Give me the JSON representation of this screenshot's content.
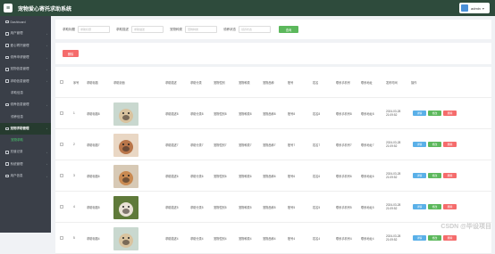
{
  "app": {
    "title": "宠物爱心寄托求助系统",
    "logo_letter": "≡"
  },
  "user": {
    "name": "admin",
    "caret": "▾"
  },
  "sidebar": {
    "items": [
      {
        "label": "Dashboard",
        "caret": ""
      },
      {
        "label": "用户管理",
        "caret": "›"
      },
      {
        "label": "爱心寄托管理",
        "caret": "›"
      },
      {
        "label": "领养申请管理",
        "caret": "›"
      },
      {
        "label": "宠物信息管理",
        "caret": "›"
      },
      {
        "label": "求助信息管理",
        "caret": "›"
      },
      {
        "label": "求助信息",
        "caret": "",
        "sub": true
      },
      {
        "label": "领养信息管理",
        "caret": "›"
      },
      {
        "label": "领养信息",
        "caret": "",
        "sub": true
      },
      {
        "label": "宠物求助管理",
        "caret": "›",
        "active": true
      },
      {
        "label": "宠物求助",
        "caret": "",
        "sub": true,
        "sub_active": true
      },
      {
        "label": "充值记录",
        "caret": "›"
      },
      {
        "label": "系统管理",
        "caret": "›"
      },
      {
        "label": "用户信息",
        "caret": "›"
      }
    ]
  },
  "search": {
    "fields": [
      {
        "label": "求助标题",
        "placeholder": "求助标题"
      },
      {
        "label": "求助描述",
        "placeholder": "求助描述"
      },
      {
        "label": "宠物种类",
        "placeholder": "宠物种类"
      },
      {
        "label": "领养状态",
        "placeholder": "领养状态"
      }
    ],
    "button": "查询"
  },
  "actions": {
    "delete": "删除"
  },
  "table": {
    "headers": [
      "序号",
      "求助标题",
      "求助封面",
      "求助描述",
      "求助分类",
      "宠物性别",
      "宠物种类",
      "宠物品种",
      "账号",
      "姓名",
      "联系手机号",
      "联系地址",
      "发布时间",
      "操作"
    ],
    "ops": {
      "detail": "详情",
      "edit": "修改",
      "delete": "删除"
    },
    "rows": [
      {
        "idx": "1",
        "title": "求助标题8",
        "desc": "求助描述8",
        "cat": "求助分类8",
        "sex": "宠物性别8",
        "kind": "宠物种类8",
        "breed": "宠物品种8",
        "acct": "账号8",
        "name": "姓名8",
        "phone": "联系手机号8",
        "addr": "联系地址8",
        "time": "2024-03-28 21:09:52",
        "pet": "pug"
      },
      {
        "idx": "2",
        "title": "求助标题7",
        "desc": "求助描述7",
        "cat": "求助分类7",
        "sex": "宠物性别7",
        "kind": "宠物种类7",
        "breed": "宠物品种7",
        "acct": "账号7",
        "name": "姓名7",
        "phone": "联系手机号7",
        "addr": "联系地址7",
        "time": "2024-03-28 21:09:52",
        "pet": "poodle"
      },
      {
        "idx": "3",
        "title": "求助标题6",
        "desc": "求助描述6",
        "cat": "求助分类6",
        "sex": "宠物性别6",
        "kind": "宠物种类6",
        "breed": "宠物品种6",
        "acct": "账号6",
        "name": "姓名6",
        "phone": "联系手机号6",
        "addr": "联系地址6",
        "time": "2024-03-28 21:09:52",
        "pet": "dog"
      },
      {
        "idx": "4",
        "title": "求助标题5",
        "desc": "求助描述5",
        "cat": "求助分类5",
        "sex": "宠物性别5",
        "kind": "宠物种类5",
        "breed": "宠物品种5",
        "acct": "账号5",
        "name": "姓名5",
        "phone": "联系手机号5",
        "addr": "联系地址5",
        "time": "2024-03-28 21:09:52",
        "pet": "frenchie"
      },
      {
        "idx": "5",
        "title": "求助标题4",
        "desc": "求助描述4",
        "cat": "求助分类4",
        "sex": "宠物性别4",
        "kind": "宠物种类4",
        "breed": "宠物品种4",
        "acct": "账号4",
        "name": "姓名4",
        "phone": "联系手机号4",
        "addr": "联系地址4",
        "time": "2024-03-28 21:09:52",
        "pet": "pug"
      }
    ]
  },
  "watermark": "CSDN @毕设项目",
  "colors": {
    "topbar": "#2e4b3c",
    "sidebar": "#3a3f48",
    "accent_green": "#5cb85c",
    "danger": "#f56c6c",
    "info": "#5ab0e8"
  }
}
